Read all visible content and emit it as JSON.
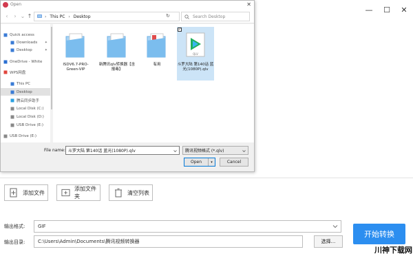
{
  "app": {
    "window_controls": {
      "minimize": "—",
      "maximize": "☐",
      "close": "✕"
    },
    "buttons": {
      "add_file": "添加文件",
      "add_folder": "添加文件夹",
      "clear_list": "清空列表"
    },
    "output_format": {
      "label": "输出格式:",
      "value": "GIF"
    },
    "output_dir": {
      "label": "输出目录:",
      "value": "C:\\Users\\Admin\\Documents\\腾讯视频转换器",
      "choose_label": "选择..."
    },
    "start_label": "开始转换",
    "watermark": "川神下载网",
    "accent_color": "#2c8ef0"
  },
  "dialog": {
    "title": "Open",
    "close": "✕",
    "nav": {
      "back": "‹",
      "forward": "›",
      "down": "⌄",
      "up": "↑",
      "refresh": "↻"
    },
    "address": [
      "This PC",
      "Desktop"
    ],
    "address_sep": "›",
    "search_placeholder": "Search Desktop",
    "sidebar": [
      {
        "label": "Quick access",
        "icon": "star-icon",
        "pin": false,
        "sel": false
      },
      {
        "label": "Downloads",
        "icon": "download-icon",
        "pin": true,
        "sel": false
      },
      {
        "label": "Desktop",
        "icon": "desktop-icon",
        "pin": true,
        "sel": false
      },
      {
        "label": "OneDrive - White",
        "icon": "cloud-icon",
        "pin": false,
        "sel": false
      },
      {
        "label": "WPS网盘",
        "icon": "cloud-drive-icon",
        "pin": false,
        "sel": false
      },
      {
        "label": "This PC",
        "icon": "computer-icon",
        "pin": false,
        "sel": false
      },
      {
        "label": "Desktop",
        "icon": "desktop-icon",
        "pin": false,
        "sel": true
      },
      {
        "label": "腾云同步助手",
        "icon": "sync-icon",
        "pin": false,
        "sel": false
      },
      {
        "label": "Local Disk (C:)",
        "icon": "drive-icon",
        "pin": false,
        "sel": false
      },
      {
        "label": "Local Disk (D:)",
        "icon": "drive-icon",
        "pin": false,
        "sel": false
      },
      {
        "label": "USB Drive (E:)",
        "icon": "usb-icon",
        "pin": false,
        "sel": false
      },
      {
        "label": "USB Drive (E:)",
        "icon": "usb-icon",
        "pin": false,
        "sel": false
      }
    ],
    "files": [
      {
        "name": "ISDV6.7-PRO-Green-VIP",
        "type": "folder"
      },
      {
        "name": "新腾讯qlv转换器【含报毒】",
        "type": "folder"
      },
      {
        "name": "有用",
        "type": "folder"
      },
      {
        "name": "斗罗大陆 第140话 蓝光(1080P).qlv",
        "type": "qlv",
        "selected": true,
        "checkmark": "✓"
      }
    ],
    "file_name_label": "File name:",
    "file_name_value": "斗罗大陆 第140话 蓝光(1080P).qlv",
    "filter_value": "腾讯视频格式 (*.qlv)",
    "open_label": "Open",
    "open_split": "▾",
    "cancel_label": "Cancel"
  }
}
